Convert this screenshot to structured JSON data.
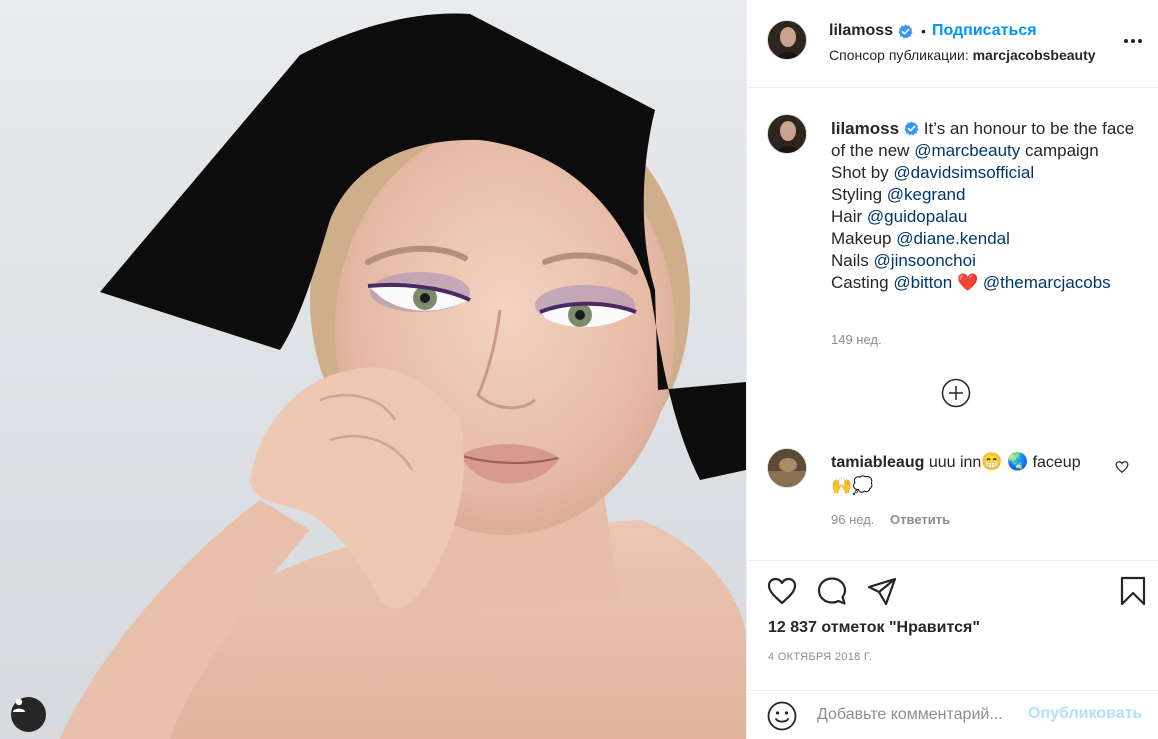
{
  "post": {
    "username": "lilamoss",
    "follow_label": "Подписаться",
    "separator": "•",
    "sponsor_prefix": "Спонсор публикации:",
    "sponsor_name": "marcjacobsbeauty"
  },
  "caption": {
    "username": "lilamoss",
    "t1": "It’s an honour to be the face of the new",
    "m1": "@marcbeauty",
    "t2": "campaign",
    "shot_by": "Shot by",
    "m2": "@davidsimsofficial",
    "styling": "Styling",
    "m3": "@kegrand",
    "hair": "Hair",
    "m4": "@guidopalau",
    "makeup": "Makeup",
    "m5": "@diane.kendal",
    "nails": "Nails",
    "m6": "@jinsoonchoi",
    "casting": "Casting",
    "m7": "@bitton",
    "heart": "❤️",
    "m8": "@themarcjacobs",
    "time": "149 нед."
  },
  "comment": {
    "username": "tamiableaug",
    "text1": "uuu inn",
    "emoji1": "😁",
    "emoji2": "🌏",
    "text2": "faceup",
    "emoji3": "🙌",
    "emoji4": "💭",
    "time": "96 нед.",
    "reply": "Ответить"
  },
  "stats": {
    "likes": "12 837 отметок \"Нравится\"",
    "date": "4 ОКТЯБРЯ 2018 Г."
  },
  "add_comment": {
    "placeholder": "Добавьте комментарий...",
    "publish": "Опубликовать"
  },
  "icons": {
    "verified": "verified-badge-icon",
    "more": "more-options-icon",
    "plus": "load-more-icon",
    "like": "heart-icon",
    "comment": "comment-bubble-icon",
    "share": "paper-plane-icon",
    "save": "bookmark-icon",
    "emoji": "smiley-icon",
    "user_tag": "user-tag-icon"
  },
  "colors": {
    "accent": "#0095f6",
    "mention": "#00376b",
    "muted": "#8e8e8e",
    "publish_disabled": "#b2dffc"
  }
}
